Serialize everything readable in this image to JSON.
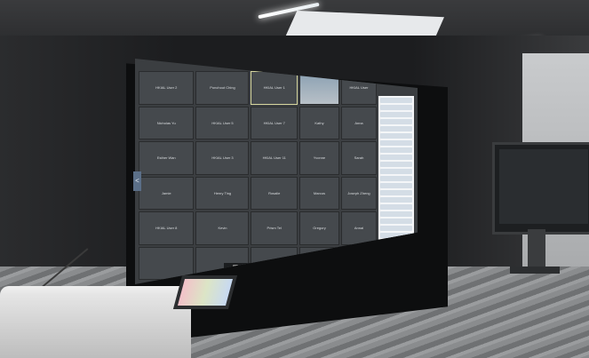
{
  "scene": {
    "description": ""
  },
  "meeting": {
    "tiles": [
      {
        "label": "HKIAL User 2"
      },
      {
        "label": "Ponchout Ching"
      },
      {
        "label": "HKIAL User 1",
        "active": true
      },
      {
        "label": "",
        "video": true
      },
      {
        "label": "HKIAL User"
      },
      {
        "label": "Nicholas Yu"
      },
      {
        "label": "HKIAL User 5"
      },
      {
        "label": "HKIAL User 7"
      },
      {
        "label": "Kathy"
      },
      {
        "label": "Anna"
      },
      {
        "label": "Esther Wan"
      },
      {
        "label": "HKIAL User 3"
      },
      {
        "label": "HKIAL User 11"
      },
      {
        "label": "Yvonne"
      },
      {
        "label": "Sarah"
      },
      {
        "label": "Jamie"
      },
      {
        "label": "Henry Ting"
      },
      {
        "label": "Rosalie"
      },
      {
        "label": "Marcus"
      },
      {
        "label": "Joseph Zheng"
      },
      {
        "label": "HKIAL User 8"
      },
      {
        "label": "Kevin"
      },
      {
        "label": "Prism Tel"
      },
      {
        "label": "Gregory"
      },
      {
        "label": "Annal"
      },
      {
        "label": ""
      },
      {
        "label": ""
      },
      {
        "label": ""
      },
      {
        "label": ""
      },
      {
        "label": ""
      }
    ],
    "arrow": "<"
  },
  "colors": {
    "screen_bg": "#3b3e41",
    "tile_bg": "#45494d",
    "accent": "#e98c2b"
  }
}
